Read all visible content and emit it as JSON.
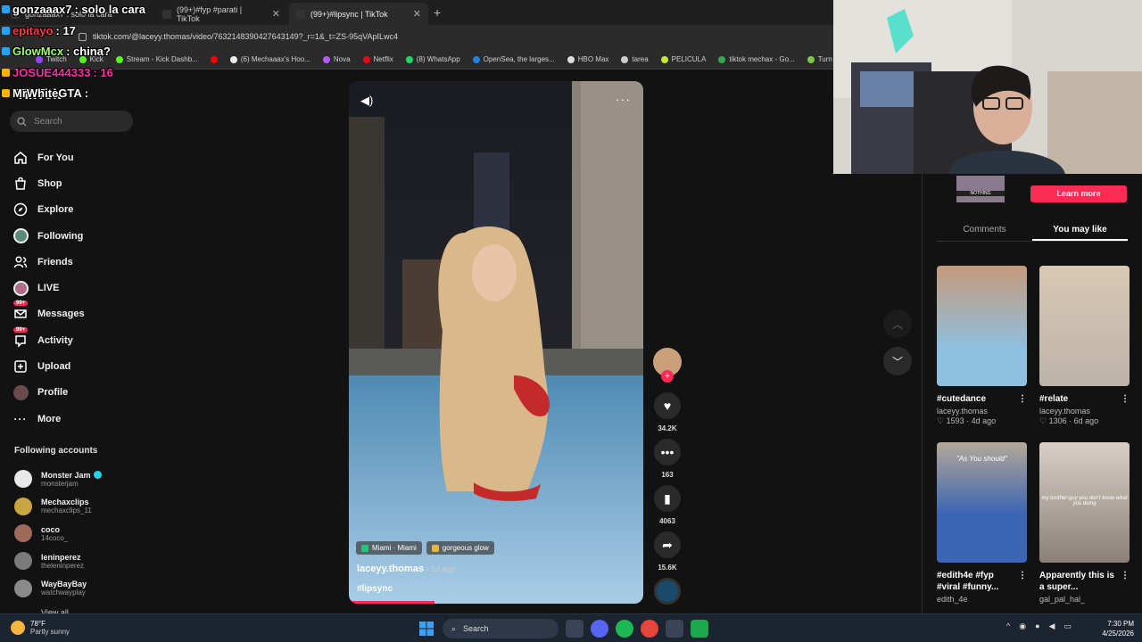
{
  "browser": {
    "tabs": [
      {
        "label": "gonzaaax7 : solo la cara",
        "active": false
      },
      {
        "label": "(99+)#fyp #parati | TikTok",
        "active": false
      },
      {
        "label": "(99+)#lipsync | TikTok",
        "active": true
      }
    ],
    "url": "tiktok.com/@laceyy.thomas/video/7632148390427643149?_r=1&_t=ZS-95qVApILwc4",
    "bookmarks": [
      "Twitch",
      "Kick",
      "Stream - Kick Dashb...",
      "",
      "(6) Mechaaax's Hoo...",
      "Nova",
      "Netflix",
      "(8) WhatsApp",
      "OpenSea, the larges...",
      "HBO Max",
      "tarea",
      "PELICULA",
      "tiktok mechax - Go...",
      "Turn You"
    ]
  },
  "chat": [
    {
      "user": "gonzaaax7",
      "text": ": solo la cara",
      "color": "#ffffff"
    },
    {
      "user": "epitayo",
      "text": ": 17",
      "color": "#ff3b3b"
    },
    {
      "user": "GlowMcx",
      "text": ": china?",
      "color": "#9eff6e"
    },
    {
      "user": "JOSUE444333",
      "text": ": 16",
      "color": "#ff2fa8"
    },
    {
      "user": "MrWhiteGTA",
      "text": ":",
      "color": "#ffffff"
    }
  ],
  "sidebar": {
    "logo": "TikTok",
    "search_placeholder": "Search",
    "items": [
      {
        "label": "For You",
        "icon": "home-icon"
      },
      {
        "label": "Shop",
        "icon": "shop-icon"
      },
      {
        "label": "Explore",
        "icon": "compass-icon"
      },
      {
        "label": "Following",
        "icon": "following-icon"
      },
      {
        "label": "Friends",
        "icon": "friends-icon"
      },
      {
        "label": "LIVE",
        "icon": "live-icon"
      },
      {
        "label": "Messages",
        "icon": "messages-icon",
        "badge": "99+"
      },
      {
        "label": "Activity",
        "icon": "activity-icon",
        "badge": "99+"
      },
      {
        "label": "Upload",
        "icon": "upload-icon"
      },
      {
        "label": "Profile",
        "icon": "profile-icon"
      },
      {
        "label": "More",
        "icon": "more-icon"
      }
    ],
    "following_title": "Following accounts",
    "following": [
      {
        "name": "Monster Jam",
        "handle": "monsterjam",
        "verified": true,
        "color": "#e8e8e8"
      },
      {
        "name": "Mechaxclips",
        "handle": "mechaxclips_11",
        "verified": false,
        "color": "#c9a640"
      },
      {
        "name": "coco",
        "handle": "14coco_",
        "verified": false,
        "color": "#a06a5a"
      },
      {
        "name": "leninperez",
        "handle": "theleninperez",
        "verified": false,
        "color": "#7a7a7a"
      },
      {
        "name": "WayBayBay",
        "handle": "watchwayplay",
        "verified": false,
        "color": "#8a8a8a"
      }
    ],
    "view_all": "View all"
  },
  "video": {
    "tags": [
      {
        "label": "Miami · Miami",
        "color": "#23c77a"
      },
      {
        "label": "gorgeous glow",
        "color": "#e8b640"
      }
    ],
    "author": "laceyy.thomas",
    "ago": " · 1d ago",
    "caption": "#lipsync",
    "progress": 0.29
  },
  "actions": {
    "likes": "34.2K",
    "comments": "163",
    "saves": "4063",
    "shares": "15.6K"
  },
  "right_panel": {
    "ad_thumb_text": "NOTHING",
    "learn_more": "Learn more",
    "tabs": [
      "Comments",
      "You may like"
    ],
    "active_tab": 1,
    "cards": [
      {
        "title": "#cutedance",
        "user": "laceyy.thomas",
        "likes": "1593",
        "ago": "4d ago",
        "overlay": "",
        "color": "#c49a7c"
      },
      {
        "title": "#relate",
        "user": "laceyy.thomas",
        "likes": "1306",
        "ago": "6d ago",
        "overlay": "",
        "color": "#bdb3a8"
      },
      {
        "title": "#edith4e #fyp #viral #funny...",
        "user": "edith_4e",
        "likes": "",
        "ago": "",
        "overlay": "\"As You should\"",
        "color": "#8a7a6a"
      },
      {
        "title": "Apparently this is a super...",
        "user": "gal_pal_hal_",
        "likes": "",
        "ago": "",
        "overlay": "my brother-guy you don't know what you doing",
        "color": "#c8c0b8"
      }
    ]
  },
  "taskbar": {
    "temp": "78°F",
    "weather": "Partly sunny",
    "search": "Search",
    "time": "7:30 PM",
    "date": "4/25/2026"
  }
}
